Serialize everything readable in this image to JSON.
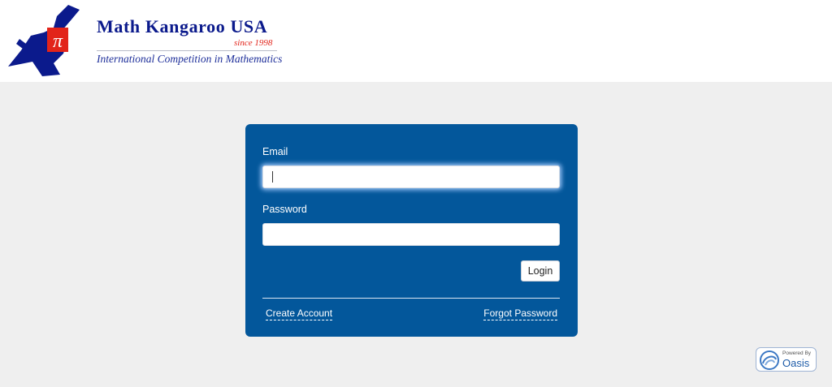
{
  "brand": {
    "name": "Math Kangaroo USA",
    "since": "since 1998",
    "tagline": "International Competition in Mathematics",
    "logo_mark": "π",
    "logo_icon": "kangaroo-pi-logo",
    "colors": {
      "navy": "#0b1a8c",
      "red": "#e2241a"
    }
  },
  "login": {
    "email_label": "Email",
    "email_value": "",
    "password_label": "Password",
    "password_value": "",
    "login_label": "Login",
    "create_account_label": "Create Account",
    "forgot_password_label": "Forgot Password",
    "card_color": "#03579b"
  },
  "footer": {
    "powered_by": "Powered By",
    "product": "Oasis",
    "icon": "oasis-swirl-icon"
  },
  "page": {
    "background": "#efefef"
  }
}
